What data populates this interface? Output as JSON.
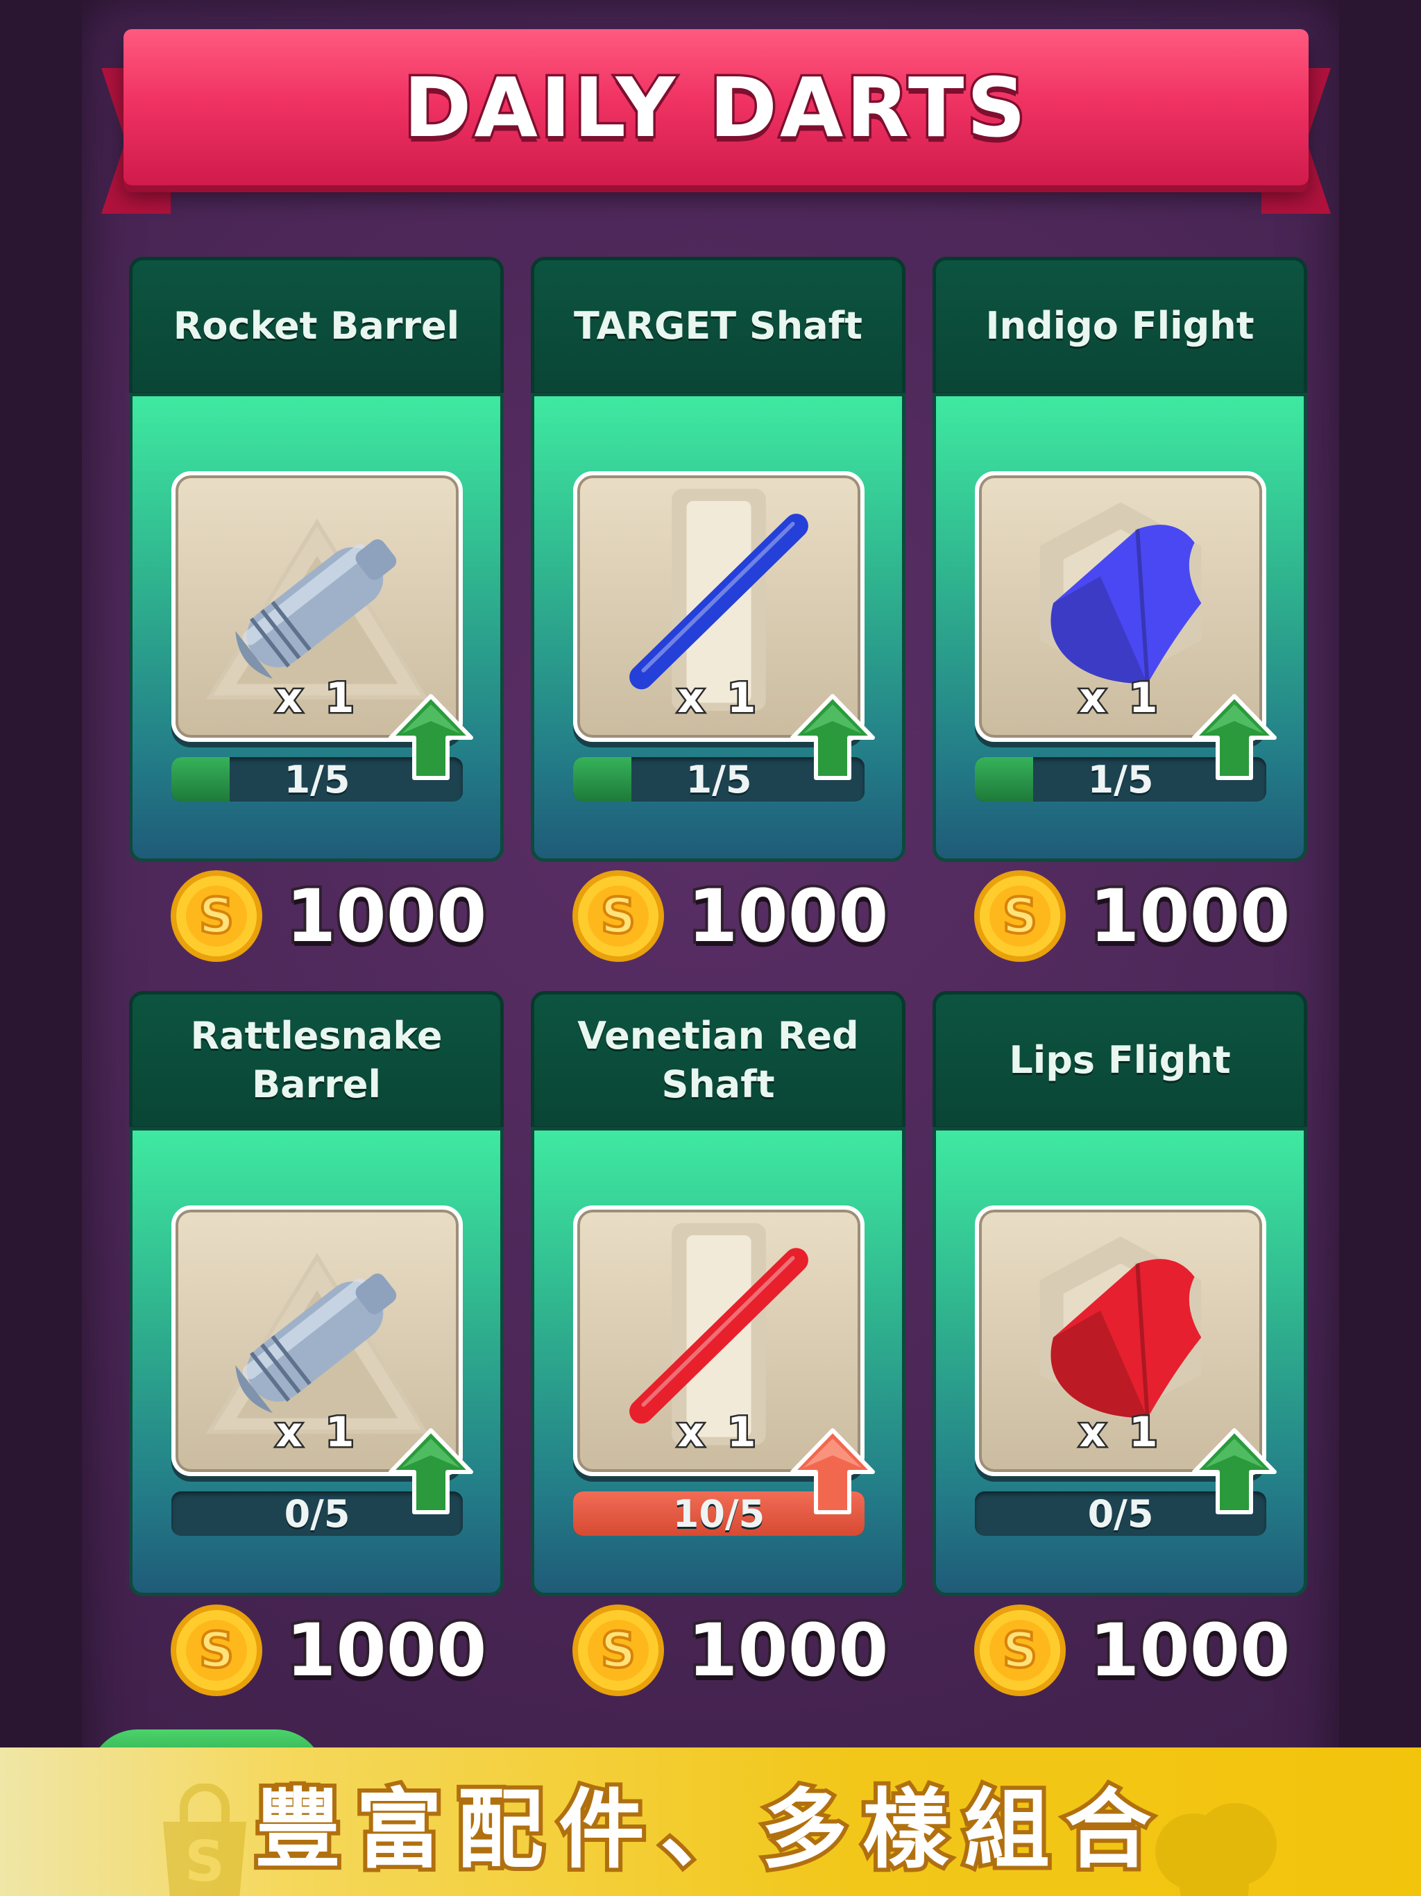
{
  "header": {
    "title": "DAILY DARTS"
  },
  "items": [
    {
      "name": "Rocket Barrel",
      "type": "barrel",
      "color": "#9fb1c9",
      "quantity": "x 1",
      "progress_text": "1/5",
      "progress": 0.2,
      "price": "1000"
    },
    {
      "name": "TARGET Shaft",
      "type": "shaft",
      "color": "#2440d8",
      "quantity": "x 1",
      "progress_text": "1/5",
      "progress": 0.2,
      "price": "1000"
    },
    {
      "name": "Indigo Flight",
      "type": "flight",
      "color": "#4a48f2",
      "quantity": "x 1",
      "progress_text": "1/5",
      "progress": 0.2,
      "price": "1000"
    },
    {
      "name": "Rattlesnake Barrel",
      "type": "barrel",
      "color": "#9fb1c9",
      "quantity": "x 1",
      "progress_text": "0/5",
      "progress": 0,
      "price": "1000"
    },
    {
      "name": "Venetian Red Shaft",
      "type": "shaft",
      "color": "#e8202c",
      "quantity": "x 1",
      "progress_text": "10/5",
      "progress": 2,
      "price": "1000"
    },
    {
      "name": "Lips Flight",
      "type": "flight",
      "color": "#e6202e",
      "quantity": "x 1",
      "progress_text": "0/5",
      "progress": 0,
      "price": "1000"
    }
  ],
  "banner": {
    "text": "豐富配件、多樣組合"
  },
  "colors": {
    "ribbon": "#f03363",
    "upgrade_green": "#2a9a3c",
    "upgrade_orange": "#f2684f",
    "coin": "#f6b820"
  }
}
